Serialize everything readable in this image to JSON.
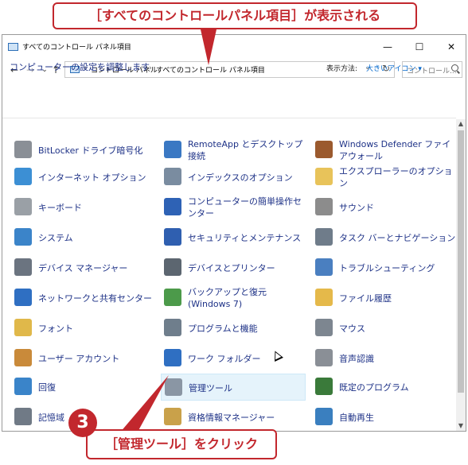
{
  "annotations": {
    "top_callout": "［すべてのコントロールパネル項目］が表示される",
    "bottom_callout": "［管理ツール］をクリック",
    "step_number": "3"
  },
  "window": {
    "title": "すべてのコントロール パネル項目",
    "minimize": "—",
    "maximize": "☐",
    "close": "✕"
  },
  "nav": {
    "back": "←",
    "forward": "→",
    "recent": "⌄",
    "up": "↑",
    "breadcrumb": [
      "コントロール パネル",
      "すべてのコントロール パネル項目"
    ],
    "separator": "›",
    "dropdown": "⌄",
    "refresh": "↻",
    "search_placeholder": "コントロール..."
  },
  "header": {
    "title": "コンピューターの設定を調整します",
    "view_label": "表示方法:",
    "view_value": "大きいアイコン ▾"
  },
  "colors": {
    "accent": "#c2272d",
    "link": "#1e3287",
    "hover": "#e5f3fb"
  },
  "items": [
    {
      "label": "BitLocker ドライブ暗号化",
      "icon": "bitlocker-icon"
    },
    {
      "label": "RemoteApp とデスクトップ接続",
      "icon": "remoteapp-icon"
    },
    {
      "label": "Windows Defender ファイアウォール",
      "icon": "firewall-icon"
    },
    {
      "label": "インターネット オプション",
      "icon": "internet-options-icon"
    },
    {
      "label": "インデックスのオプション",
      "icon": "indexing-icon"
    },
    {
      "label": "エクスプローラーのオプション",
      "icon": "explorer-options-icon"
    },
    {
      "label": "キーボード",
      "icon": "keyboard-icon"
    },
    {
      "label": "コンピューターの簡単操作センター",
      "icon": "ease-of-access-icon"
    },
    {
      "label": "サウンド",
      "icon": "sound-icon"
    },
    {
      "label": "システム",
      "icon": "system-icon"
    },
    {
      "label": "セキュリティとメンテナンス",
      "icon": "security-flag-icon"
    },
    {
      "label": "タスク バーとナビゲーション",
      "icon": "taskbar-icon"
    },
    {
      "label": "デバイス マネージャー",
      "icon": "device-manager-icon"
    },
    {
      "label": "デバイスとプリンター",
      "icon": "printer-icon"
    },
    {
      "label": "トラブルシューティング",
      "icon": "troubleshooting-icon"
    },
    {
      "label": "ネットワークと共有センター",
      "icon": "network-icon"
    },
    {
      "label": "バックアップと復元 (Windows 7)",
      "icon": "backup-icon"
    },
    {
      "label": "ファイル履歴",
      "icon": "file-history-icon"
    },
    {
      "label": "フォント",
      "icon": "font-icon"
    },
    {
      "label": "プログラムと機能",
      "icon": "programs-icon"
    },
    {
      "label": "マウス",
      "icon": "mouse-icon"
    },
    {
      "label": "ユーザー アカウント",
      "icon": "user-accounts-icon"
    },
    {
      "label": "ワーク フォルダー",
      "icon": "work-folders-icon"
    },
    {
      "label": "音声認識",
      "icon": "microphone-icon"
    },
    {
      "label": "回復",
      "icon": "recovery-icon"
    },
    {
      "label": "管理ツール",
      "icon": "admin-tools-icon"
    },
    {
      "label": "既定のプログラム",
      "icon": "default-programs-icon"
    },
    {
      "label": "記憶域",
      "icon": "storage-icon"
    },
    {
      "label": "資格情報マネージャー",
      "icon": "credential-manager-icon"
    },
    {
      "label": "自動再生",
      "icon": "autoplay-icon"
    }
  ]
}
